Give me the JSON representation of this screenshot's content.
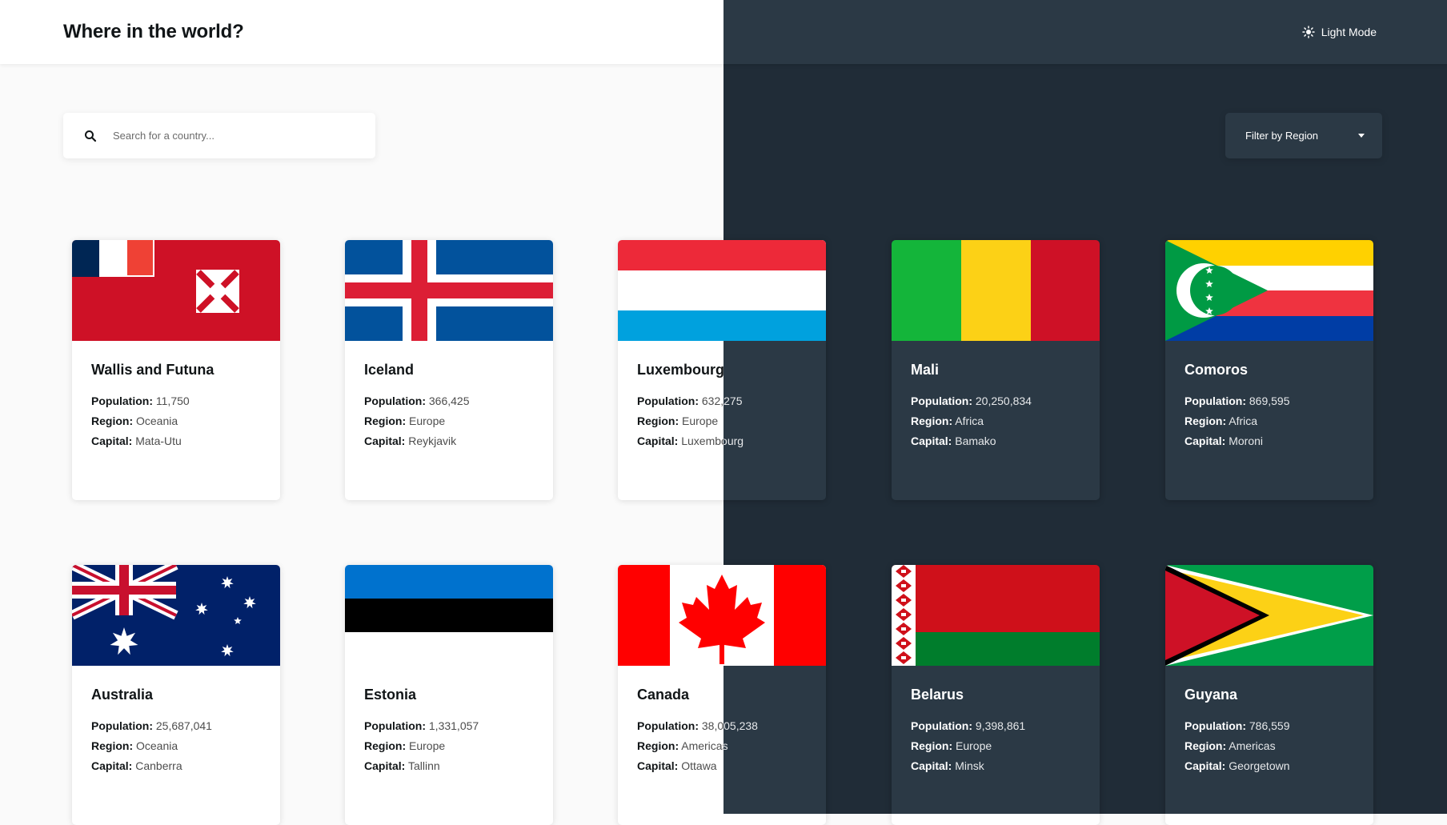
{
  "header": {
    "title": "Where in the world?",
    "theme_toggle_label": "Light Mode",
    "theme_icon": "sun-icon"
  },
  "search": {
    "placeholder": "Search for a country...",
    "value": "",
    "icon": "search-icon"
  },
  "filter": {
    "label": "Filter by Region",
    "icon": "caret-down-icon"
  },
  "labels": {
    "population": "Population:",
    "region": "Region:",
    "capital": "Capital:"
  },
  "countries": [
    {
      "name": "Wallis and Futuna",
      "population": "11,750",
      "region": "Oceania",
      "capital": "Mata-Utu",
      "flag": "wallis-and-futuna-flag"
    },
    {
      "name": "Iceland",
      "population": "366,425",
      "region": "Europe",
      "capital": "Reykjavik",
      "flag": "iceland-flag"
    },
    {
      "name": "Luxembourg",
      "population": "632,275",
      "region": "Europe",
      "capital": "Luxembourg",
      "flag": "luxembourg-flag"
    },
    {
      "name": "Mali",
      "population": "20,250,834",
      "region": "Africa",
      "capital": "Bamako",
      "flag": "mali-flag"
    },
    {
      "name": "Comoros",
      "population": "869,595",
      "region": "Africa",
      "capital": "Moroni",
      "flag": "comoros-flag"
    },
    {
      "name": "Australia",
      "population": "25,687,041",
      "region": "Oceania",
      "capital": "Canberra",
      "flag": "australia-flag"
    },
    {
      "name": "Estonia",
      "population": "1,331,057",
      "region": "Europe",
      "capital": "Tallinn",
      "flag": "estonia-flag"
    },
    {
      "name": "Canada",
      "population": "38,005,238",
      "region": "Americas",
      "capital": "Ottawa",
      "flag": "canada-flag"
    },
    {
      "name": "Belarus",
      "population": "9,398,861",
      "region": "Europe",
      "capital": "Minsk",
      "flag": "belarus-flag"
    },
    {
      "name": "Guyana",
      "population": "786,559",
      "region": "Americas",
      "capital": "Georgetown",
      "flag": "guyana-flag"
    }
  ],
  "colors": {
    "light_bg": "#fafafa",
    "dark_bg": "#202c37",
    "dark_element": "#2b3945",
    "light_text": "#111517"
  }
}
